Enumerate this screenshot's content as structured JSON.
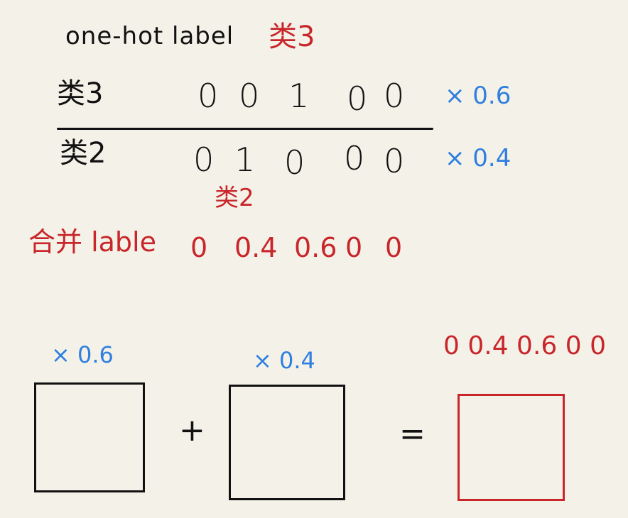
{
  "header": {
    "title": "one-hot label",
    "class_tag": "类3"
  },
  "rows": [
    {
      "label": "类3",
      "bits": [
        "0",
        "0",
        "1",
        "0",
        "0"
      ],
      "multiplier": "× 0.6"
    },
    {
      "label": "类2",
      "bits": [
        "0",
        "1",
        "0",
        "0",
        "0"
      ],
      "multiplier": "× 0.4"
    }
  ],
  "annotation": "类2",
  "merged": {
    "label": "合并 lable",
    "values": [
      "0",
      "0.4",
      "0.6",
      "0",
      "0"
    ]
  },
  "bottom": {
    "left_weight": "× 0.6",
    "right_weight": "× 0.4",
    "plus": "+",
    "equals": "=",
    "result_values": "0  0.4  0.6  0 0"
  },
  "colors": {
    "ink": "#111111",
    "red": "#c8262b",
    "blue": "#2f7fe0",
    "paper": "#f4f2e8"
  }
}
